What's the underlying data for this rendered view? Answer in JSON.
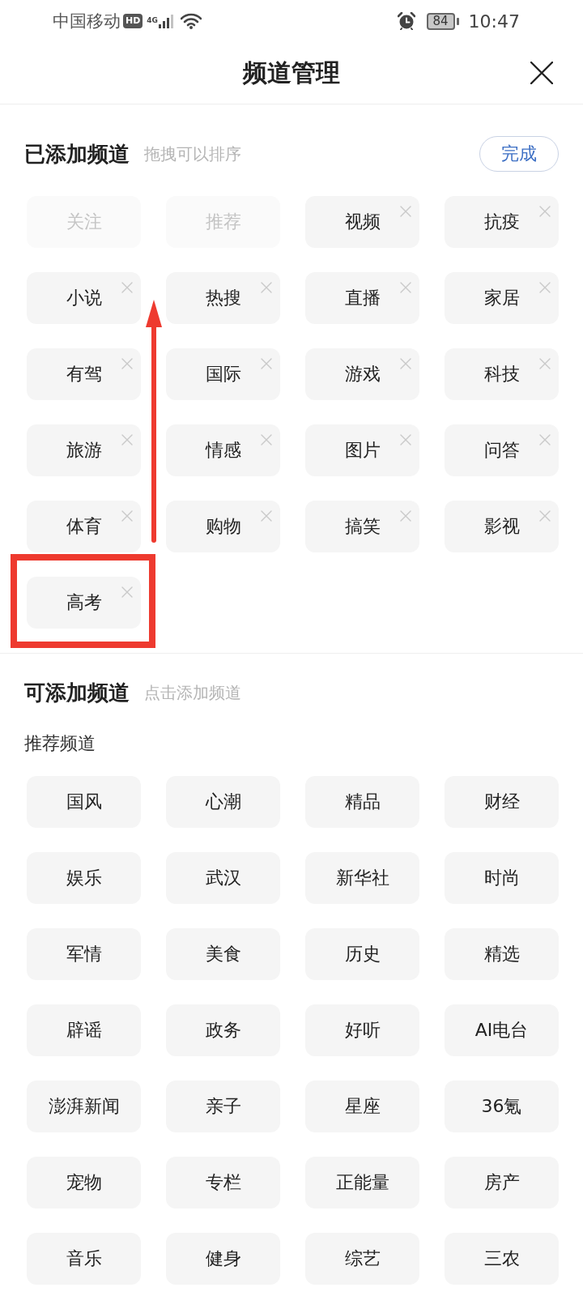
{
  "status_bar": {
    "carrier": "中国移动",
    "hd_badge": "HD",
    "network_type": "4G",
    "battery": "84",
    "time": "10:47"
  },
  "header": {
    "title": "频道管理"
  },
  "added_section": {
    "title": "已添加频道",
    "hint": "拖拽可以排序",
    "done_button": "完成",
    "channels": [
      {
        "label": "关注",
        "disabled": true,
        "highlighted": false
      },
      {
        "label": "推荐",
        "disabled": true,
        "highlighted": false
      },
      {
        "label": "视频",
        "disabled": false,
        "highlighted": false
      },
      {
        "label": "抗疫",
        "disabled": false,
        "highlighted": false
      },
      {
        "label": "小说",
        "disabled": false,
        "highlighted": false
      },
      {
        "label": "热搜",
        "disabled": false,
        "highlighted": false
      },
      {
        "label": "直播",
        "disabled": false,
        "highlighted": false
      },
      {
        "label": "家居",
        "disabled": false,
        "highlighted": false
      },
      {
        "label": "有驾",
        "disabled": false,
        "highlighted": false
      },
      {
        "label": "国际",
        "disabled": false,
        "highlighted": false
      },
      {
        "label": "游戏",
        "disabled": false,
        "highlighted": false
      },
      {
        "label": "科技",
        "disabled": false,
        "highlighted": false
      },
      {
        "label": "旅游",
        "disabled": false,
        "highlighted": false
      },
      {
        "label": "情感",
        "disabled": false,
        "highlighted": false
      },
      {
        "label": "图片",
        "disabled": false,
        "highlighted": false
      },
      {
        "label": "问答",
        "disabled": false,
        "highlighted": false
      },
      {
        "label": "体育",
        "disabled": false,
        "highlighted": false
      },
      {
        "label": "购物",
        "disabled": false,
        "highlighted": false
      },
      {
        "label": "搞笑",
        "disabled": false,
        "highlighted": false
      },
      {
        "label": "影视",
        "disabled": false,
        "highlighted": false
      },
      {
        "label": "高考",
        "disabled": false,
        "highlighted": true
      }
    ]
  },
  "available_section": {
    "title": "可添加频道",
    "hint": "点击添加频道",
    "group_title": "推荐频道",
    "channels": [
      "国风",
      "心潮",
      "精品",
      "财经",
      "娱乐",
      "武汉",
      "新华社",
      "时尚",
      "军情",
      "美食",
      "历史",
      "精选",
      "辟谣",
      "政务",
      "好听",
      "AI电台",
      "澎湃新闻",
      "亲子",
      "星座",
      "36氪",
      "宠物",
      "专栏",
      "正能量",
      "房产",
      "音乐",
      "健身",
      "综艺",
      "三农"
    ]
  }
}
